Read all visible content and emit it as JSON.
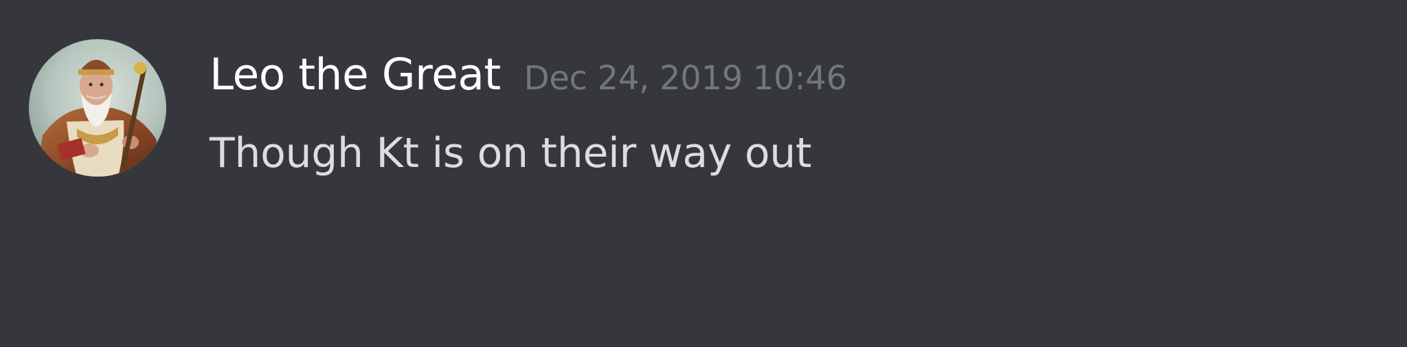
{
  "message": {
    "author": {
      "name": "Leo the Great",
      "avatar_icon": "pope-portrait-avatar"
    },
    "timestamp": "Dec 24, 2019 10:46",
    "content": "Though Kt is on their way out"
  },
  "colors": {
    "background": "#36373d",
    "username": "#ffffff",
    "timestamp": "#72767d",
    "message_text": "#dcddde"
  }
}
